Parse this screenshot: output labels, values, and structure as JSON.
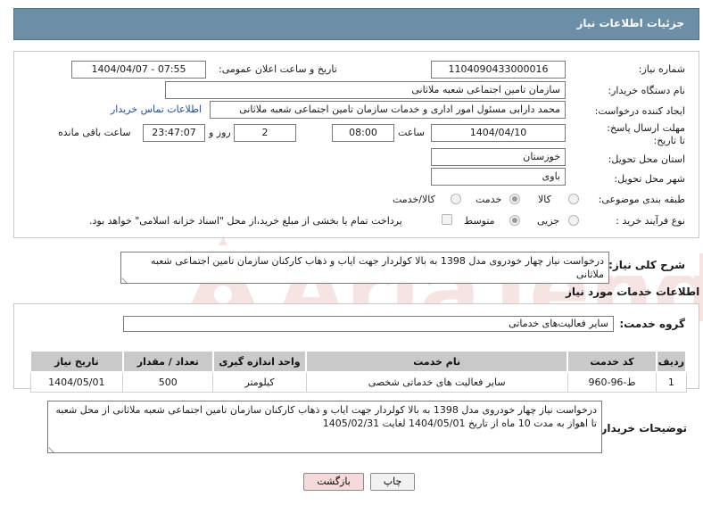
{
  "header": {
    "title": "جزئیات اطلاعات نیاز"
  },
  "form": {
    "need_number_label": "شماره نیاز:",
    "need_number": "1104090433000016",
    "announce_label": "تاریخ و ساعت اعلان عمومی:",
    "announce_value": "1404/04/07 - 07:55",
    "buyer_org_label": "نام دستگاه خریدار:",
    "buyer_org": "سازمان تامین اجتماعی شعبه ملاثانی",
    "creator_label": "ایجاد کننده درخواست:",
    "creator": "محمد دارابی مسئول امور اداری و خدمات سازمان تامین اجتماعی شعبه ملاثانی",
    "contact_link": "اطلاعات تماس خریدار",
    "deadline_label": "مهلت ارسال پاسخ: تا تاریخ:",
    "deadline_date": "1404/04/10",
    "time_label": "ساعت",
    "deadline_time": "08:00",
    "days_value": "2",
    "days_label": "روز و",
    "remaining_time": "23:47:07",
    "remaining_label": "ساعت باقی مانده",
    "province_label": "استان محل تحویل:",
    "province": "خوزستان",
    "city_label": "شهر محل تحویل:",
    "city": "باوی",
    "category_label": "طبقه بندی موضوعی:",
    "category_options": [
      "کالا",
      "خدمت",
      "کالا/خدمت"
    ],
    "purchase_type_label": "نوع فرآیند خرید :",
    "purchase_options": [
      "جزیی",
      "متوسط"
    ],
    "payment_note": "پرداخت تمام یا بخشی از مبلغ خرید،از محل \"اسناد خزانه اسلامی\" خواهد بود."
  },
  "summary": {
    "label": "شرح کلی نیاز:",
    "text": "درخواست نیاز چهار خودروی مدل 1398 به بالا کولردار جهت ایاب و ذهاب کارکنان سازمان تامین اجتماعی شعبه ملاثانی"
  },
  "services": {
    "section_title": "اطلاعات خدمات مورد نیاز",
    "group_label": "گروه خدمت:",
    "group_value": "سایر فعالیت‌های خدماتی",
    "columns": [
      "ردیف",
      "کد خدمت",
      "نام خدمت",
      "واحد اندازه گیری",
      "تعداد / مقدار",
      "تاریخ نیاز"
    ],
    "rows": [
      [
        "1",
        "ط-96-960",
        "سایر فعالیت های خدماتی شخصی",
        "کیلومتر",
        "500",
        "1404/05/01"
      ]
    ]
  },
  "buyer_notes": {
    "label": "توضیحات خریدار:",
    "text": "درخواست نیاز چهار خودروی مدل 1398 به بالا کولردار جهت ایاب و ذهاب کارکنان سازمان تامین اجتماعی شعبه ملاثانی از محل شعبه تا اهواز به مدت 10 ماه از تاریخ 1404/05/01 لغایت 1405/02/31"
  },
  "buttons": {
    "print": "چاپ",
    "back": "بازگشت"
  },
  "watermark": {
    "text": "AriaTender.neT"
  },
  "colors": {
    "header_bg": "#6b8fa6",
    "link": "#1a4fb5",
    "table_header": "#c9c9c9",
    "back_button": "#f6dada",
    "watermark": "#c0392b"
  }
}
